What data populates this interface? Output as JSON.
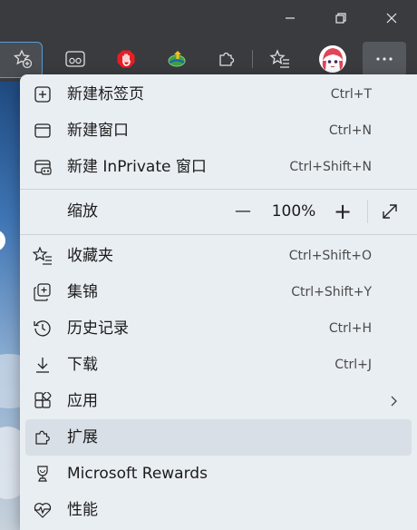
{
  "window_controls": {
    "minimize": "—",
    "restore": "❐",
    "close": "✕"
  },
  "toolbar_icons": [
    "favorite-star-add-icon",
    "reading-view-icon",
    "adblock-hand-icon",
    "downloader-icon",
    "extensions-puzzle-icon",
    "favorites-icon",
    "profile-avatar",
    "more-menu-icon"
  ],
  "menu": {
    "items": [
      {
        "label": "新建标签页",
        "shortcut": "Ctrl+T"
      },
      {
        "label": "新建窗口",
        "shortcut": "Ctrl+N"
      },
      {
        "label": "新建 InPrivate 窗口",
        "shortcut": "Ctrl+Shift+N"
      }
    ],
    "zoom": {
      "label": "缩放",
      "minus": "—",
      "value": "100%",
      "plus": "+"
    },
    "items2": [
      {
        "label": "收藏夹",
        "shortcut": "Ctrl+Shift+O"
      },
      {
        "label": "集锦",
        "shortcut": "Ctrl+Shift+Y"
      },
      {
        "label": "历史记录",
        "shortcut": "Ctrl+H"
      },
      {
        "label": "下载",
        "shortcut": "Ctrl+J"
      },
      {
        "label": "应用",
        "shortcut": ""
      },
      {
        "label": "扩展",
        "shortcut": ""
      },
      {
        "label": "Microsoft Rewards",
        "shortcut": ""
      },
      {
        "label": "性能",
        "shortcut": ""
      }
    ]
  }
}
